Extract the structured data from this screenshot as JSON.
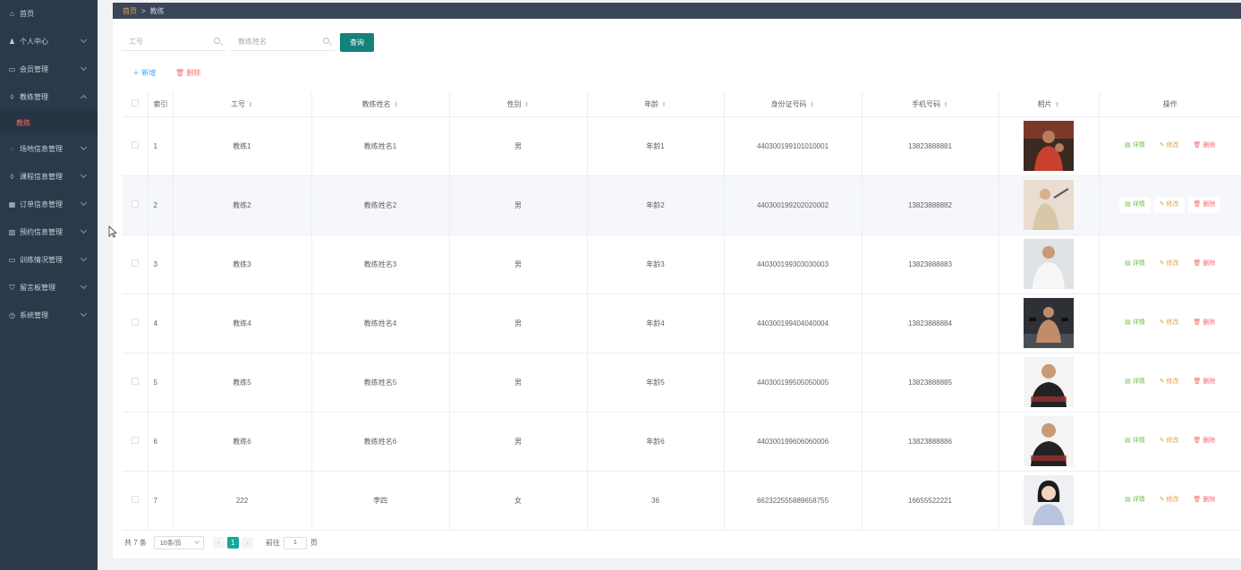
{
  "sidebar": {
    "items": [
      {
        "icon": "home-icon",
        "glyph": "⌂",
        "label": "首页",
        "chevron": ""
      },
      {
        "icon": "user-icon",
        "glyph": "♟",
        "label": "个人中心",
        "chevron": "down"
      },
      {
        "icon": "chat-icon",
        "glyph": "▭",
        "label": "会员管理",
        "chevron": "down"
      },
      {
        "icon": "bulb-icon",
        "glyph": "◊",
        "label": "教练管理",
        "chevron": "up"
      },
      {
        "icon": "circle-chat-icon",
        "glyph": "◌",
        "label": "场地信息管理",
        "chevron": "down"
      },
      {
        "icon": "bulb-icon",
        "glyph": "◊",
        "label": "课程信息管理",
        "chevron": "down"
      },
      {
        "icon": "grid-icon",
        "glyph": "▦",
        "label": "订单信息管理",
        "chevron": "down"
      },
      {
        "icon": "table-icon",
        "glyph": "▥",
        "label": "预约信息管理",
        "chevron": "down"
      },
      {
        "icon": "monitor-icon",
        "glyph": "▭",
        "label": "训练情况管理",
        "chevron": "down"
      },
      {
        "icon": "shield-icon",
        "glyph": "⛉",
        "label": "留言板管理",
        "chevron": "down"
      },
      {
        "icon": "clock-icon",
        "glyph": "◷",
        "label": "系统管理",
        "chevron": "down"
      }
    ],
    "active_sub": "教练"
  },
  "breadcrumb": {
    "home": "首页",
    "separator": ">",
    "current": "教练"
  },
  "search": {
    "field1_placeholder": "工号",
    "field2_placeholder": "教练姓名",
    "query_label": "查询"
  },
  "actions": {
    "add_label": "＋ 新增",
    "delete_label": "🗑 删除"
  },
  "table": {
    "headers": {
      "index": "索引",
      "id": "工号",
      "name": "教练姓名",
      "gender": "性别",
      "age": "年龄",
      "idcard": "身份证号码",
      "phone": "手机号码",
      "photo": "相片",
      "ops": "操作"
    },
    "rows": [
      {
        "index": "1",
        "id": "教练1",
        "name": "教练姓名1",
        "gender": "男",
        "age": "年龄1",
        "idcard": "440300199101010001",
        "phone": "13823888881"
      },
      {
        "index": "2",
        "id": "教练2",
        "name": "教练姓名2",
        "gender": "男",
        "age": "年龄2",
        "idcard": "440300199202020002",
        "phone": "13823888882"
      },
      {
        "index": "3",
        "id": "教练3",
        "name": "教练姓名3",
        "gender": "男",
        "age": "年龄3",
        "idcard": "440300199303030003",
        "phone": "13823888883"
      },
      {
        "index": "4",
        "id": "教练4",
        "name": "教练姓名4",
        "gender": "男",
        "age": "年龄4",
        "idcard": "440300199404040004",
        "phone": "13823888884"
      },
      {
        "index": "5",
        "id": "教练5",
        "name": "教练姓名5",
        "gender": "男",
        "age": "年龄5",
        "idcard": "440300199505050005",
        "phone": "13823888885"
      },
      {
        "index": "6",
        "id": "教练6",
        "name": "教练姓名6",
        "gender": "男",
        "age": "年龄6",
        "idcard": "440300199606060006",
        "phone": "13823888886"
      },
      {
        "index": "7",
        "id": "222",
        "name": "李四",
        "gender": "女",
        "age": "36",
        "idcard": "662322555889658755",
        "phone": "16655522221"
      }
    ],
    "op_labels": {
      "detail": "▤ 详情",
      "edit": "✎ 修改",
      "delete": "🗑 删除"
    }
  },
  "pagination": {
    "total": "共 7 条",
    "page_size": "10条/页",
    "current_page": "1",
    "goto_label": "前往",
    "goto_value": "1",
    "page_suffix": "页"
  },
  "colors": {
    "sidebar_bg": "#2b3a4a",
    "accent_teal": "#13827a",
    "primary_blue": "#409eff",
    "danger_red": "#f56c6c",
    "success_green": "#67c23a",
    "warning_orange": "#e6a23c"
  }
}
